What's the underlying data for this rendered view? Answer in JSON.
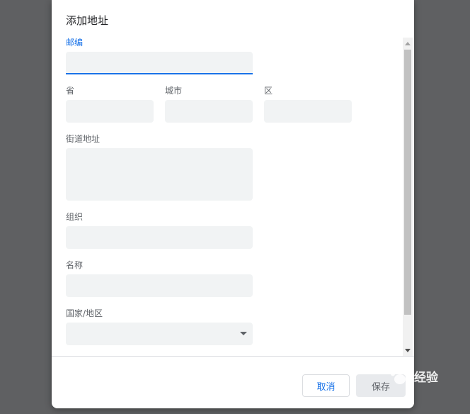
{
  "dialog": {
    "title": "添加地址",
    "fields": {
      "postal_code": {
        "label": "邮编",
        "value": ""
      },
      "province": {
        "label": "省",
        "value": ""
      },
      "city": {
        "label": "城市",
        "value": ""
      },
      "district": {
        "label": "区",
        "value": ""
      },
      "street": {
        "label": "街道地址",
        "value": ""
      },
      "organization": {
        "label": "组织",
        "value": ""
      },
      "name": {
        "label": "名称",
        "value": ""
      },
      "country": {
        "label": "国家/地区",
        "value": ""
      }
    },
    "buttons": {
      "cancel": "取消",
      "save": "保存"
    }
  },
  "watermark": {
    "text": "经验"
  },
  "colors": {
    "accent": "#1a73e8",
    "overlay": "#5f6062",
    "field_bg": "#f1f3f4"
  }
}
